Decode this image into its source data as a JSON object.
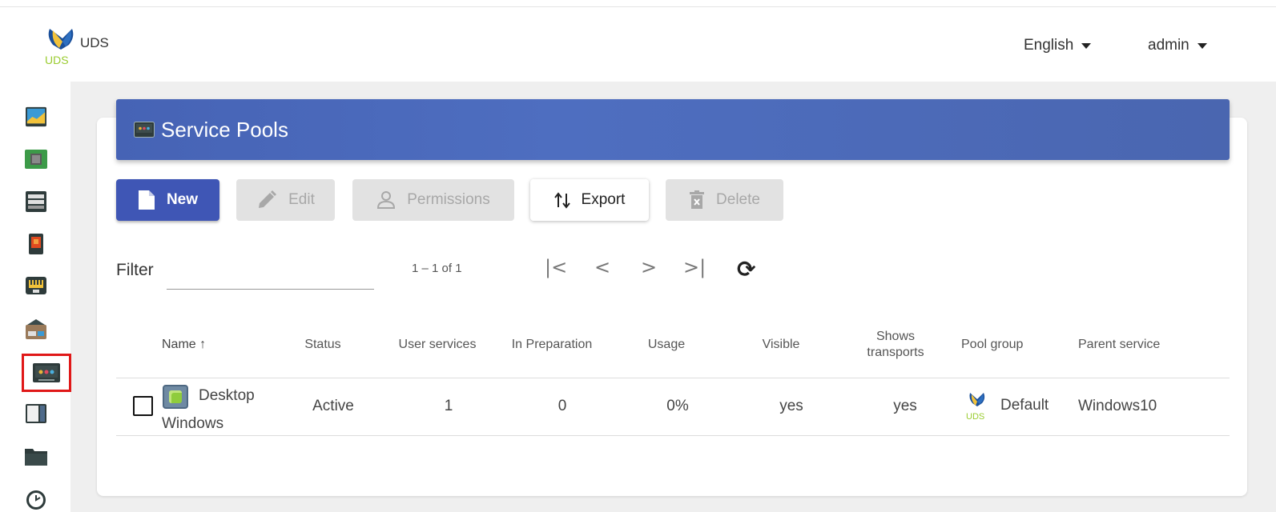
{
  "header": {
    "brand_name": "UDS",
    "logo_text": "UDS",
    "language": "English",
    "user": "admin"
  },
  "sidebar": {
    "items": [
      {
        "name": "dashboard-icon",
        "color": "#2c7a3e"
      },
      {
        "name": "services-icon",
        "color": "#3a9a44"
      },
      {
        "name": "authenticators-icon",
        "color": "#3a3a3a"
      },
      {
        "name": "os-managers-icon",
        "color": "#d04020"
      },
      {
        "name": "transports-icon",
        "color": "#3a3a3a"
      },
      {
        "name": "networks-icon",
        "color": "#7a6a5a"
      },
      {
        "name": "service-pools-icon",
        "color": "#2d3a3a",
        "active": true
      },
      {
        "name": "meta-pools-icon",
        "color": "#2d3a3a"
      },
      {
        "name": "pool-groups-icon",
        "color": "#2d3a3a"
      },
      {
        "name": "calendars-icon",
        "color": "#2d3a3a"
      }
    ]
  },
  "page": {
    "title": "Service Pools"
  },
  "toolbar": {
    "new_label": "New",
    "edit_label": "Edit",
    "permissions_label": "Permissions",
    "export_label": "Export",
    "delete_label": "Delete"
  },
  "filter": {
    "label": "Filter",
    "value": ""
  },
  "pagination": {
    "range": "1 – 1 of 1",
    "first": "|<",
    "prev": "<",
    "next": ">",
    "last": ">|",
    "refresh": "⟳"
  },
  "table": {
    "columns": {
      "name": "Name ↑",
      "status": "Status",
      "user_services": "User services",
      "in_preparation": "In Preparation",
      "usage": "Usage",
      "visible": "Visible",
      "shows_transports_1": "Shows",
      "shows_transports_2": "transports",
      "pool_group": "Pool group",
      "parent_service": "Parent service"
    },
    "rows": [
      {
        "name_line1": "Desktop",
        "name_line2": "Windows",
        "status": "Active",
        "user_services": "1",
        "in_preparation": "0",
        "usage": "0%",
        "visible": "yes",
        "shows_transports": "yes",
        "pool_group": "Default",
        "pool_group_logo_text": "UDS",
        "parent_service": "Windows10"
      }
    ]
  },
  "colors": {
    "header_blue": "#4663b5",
    "primary_button": "#3f56b5",
    "active_outline": "#e01818"
  }
}
